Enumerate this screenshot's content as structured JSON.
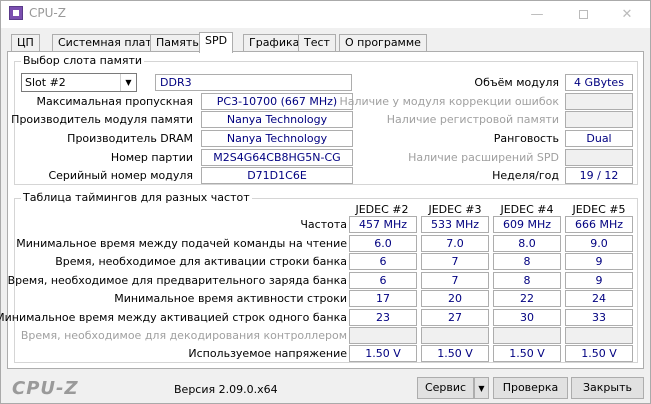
{
  "window": {
    "title": "CPU-Z",
    "minimize": "—",
    "close": "✕"
  },
  "tabs": [
    "ЦП",
    "Системная плата",
    "Память",
    "SPD",
    "Графика",
    "Тест",
    "О программе"
  ],
  "slot_group": {
    "title": "Выбор слота памяти",
    "slot_selected": "Slot #2",
    "mem_type": "DDR3",
    "rows_left": [
      {
        "label": "Максимальная пропускная",
        "value": "PC3-10700 (667 MHz)"
      },
      {
        "label": "Производитель модуля памяти",
        "value": "Nanya Technology"
      },
      {
        "label": "Производитель DRAM",
        "value": "Nanya Technology"
      },
      {
        "label": "Номер партии",
        "value": "M2S4G64CB8HG5N-CG"
      },
      {
        "label": "Серийный номер модуля",
        "value": "D71D1C6E"
      }
    ],
    "rows_right": [
      {
        "label": "Объём модуля",
        "value": "4 GBytes",
        "disabled": false
      },
      {
        "label": "Наличие у модуля коррекции ошибок",
        "value": "",
        "disabled": true
      },
      {
        "label": "Наличие регистровой памяти",
        "value": "",
        "disabled": true
      },
      {
        "label": "Ранговость",
        "value": "Dual",
        "disabled": false
      },
      {
        "label": "Наличие расширений SPD",
        "value": "",
        "disabled": true
      },
      {
        "label": "Неделя/год",
        "value": "19 / 12",
        "disabled": false
      }
    ]
  },
  "timings_group": {
    "title": "Таблица таймингов для разных частот",
    "columns": [
      "JEDEC #2",
      "JEDEC #3",
      "JEDEC #4",
      "JEDEC #5"
    ],
    "rows": [
      {
        "label": "Частота",
        "disabled": false,
        "values": [
          "457 MHz",
          "533 MHz",
          "609 MHz",
          "666 MHz"
        ]
      },
      {
        "label": "Минимальное время между подачей команды на чтение",
        "disabled": false,
        "values": [
          "6.0",
          "7.0",
          "8.0",
          "9.0"
        ]
      },
      {
        "label": "Время, необходимое для активации строки банка",
        "disabled": false,
        "values": [
          "6",
          "7",
          "8",
          "9"
        ]
      },
      {
        "label": "Время, необходимое для предварительного заряда банка",
        "disabled": false,
        "values": [
          "6",
          "7",
          "8",
          "9"
        ]
      },
      {
        "label": "Минимальное время активности строки",
        "disabled": false,
        "values": [
          "17",
          "20",
          "22",
          "24"
        ]
      },
      {
        "label": "Минимальное время между активацией строк одного банка",
        "disabled": false,
        "values": [
          "23",
          "27",
          "30",
          "33"
        ]
      },
      {
        "label": "Время, необходимое для декодирования контроллером",
        "disabled": true,
        "values": [
          "",
          "",
          "",
          ""
        ]
      },
      {
        "label": "Используемое напряжение",
        "disabled": false,
        "values": [
          "1.50 V",
          "1.50 V",
          "1.50 V",
          "1.50 V"
        ]
      }
    ]
  },
  "footer": {
    "logo": "CPU-Z",
    "version": "Версия 2.09.0.x64",
    "tools_button": "Сервис",
    "validate_button": "Проверка",
    "close_button": "Закрыть"
  }
}
